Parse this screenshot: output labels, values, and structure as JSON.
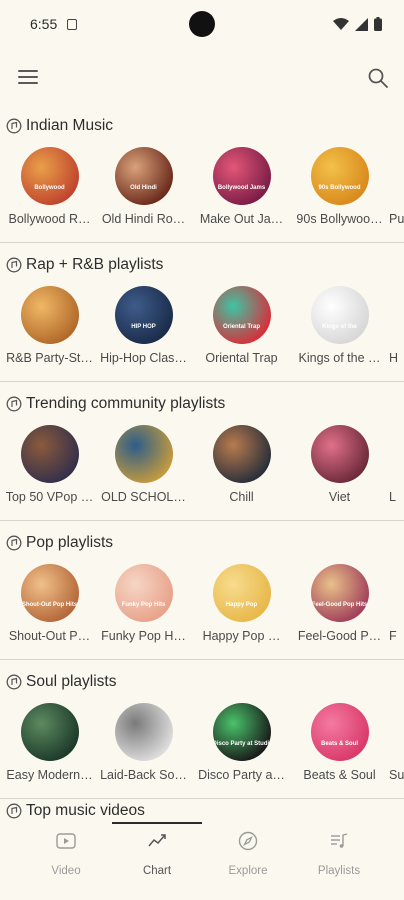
{
  "status": {
    "time": "6:55"
  },
  "sections": [
    {
      "title": "Indian Music",
      "items": [
        {
          "label": "Bollywood R…",
          "badge": "Bollywood",
          "colors": [
            "#c0442e",
            "#e9a04a"
          ]
        },
        {
          "label": "Old Hindi Ro…",
          "badge": "Old Hindi",
          "colors": [
            "#6b2a1c",
            "#d9a27a"
          ]
        },
        {
          "label": "Make Out Ja…",
          "badge": "Bollywood Jams",
          "colors": [
            "#7b1d47",
            "#e35778"
          ]
        },
        {
          "label": "90s Bollywoo…",
          "badge": "90s Bollywood",
          "colors": [
            "#d98a1c",
            "#f3c04a"
          ]
        }
      ],
      "peek": "Pu"
    },
    {
      "title": "Rap + R&B playlists",
      "items": [
        {
          "label": "R&B Party-St…",
          "badge": "",
          "colors": [
            "#b1692a",
            "#f0b866"
          ]
        },
        {
          "label": "Hip-Hop Clas…",
          "badge": "HIP HOP",
          "colors": [
            "#1b2c4a",
            "#3e5c8a"
          ]
        },
        {
          "label": "Oriental Trap",
          "badge": "Oriental Trap",
          "colors": [
            "#d6303b",
            "#3fc4a3"
          ]
        },
        {
          "label": "Kings of the …",
          "badge": "Kings of the",
          "colors": [
            "#d7d7d7",
            "#ffffff"
          ]
        }
      ],
      "peek": "H"
    },
    {
      "title": "Trending community playlists",
      "items": [
        {
          "label": "Top 50 VPop …",
          "badge": "",
          "colors": [
            "#34304a",
            "#8b5a3c"
          ]
        },
        {
          "label": "OLD SCHOL…",
          "badge": "",
          "colors": [
            "#c49a3e",
            "#2c5d8a"
          ]
        },
        {
          "label": "Chill",
          "badge": "",
          "colors": [
            "#2a2f3a",
            "#b87b4e"
          ]
        },
        {
          "label": "Viet",
          "badge": "",
          "colors": [
            "#6d2a3a",
            "#e0708a"
          ]
        }
      ],
      "peek": "L"
    },
    {
      "title": "Pop playlists",
      "items": [
        {
          "label": "Shout-Out P…",
          "badge": "Shout-Out Pop Hits",
          "colors": [
            "#b5683a",
            "#f0c08a"
          ]
        },
        {
          "label": "Funky Pop H…",
          "badge": "Funky Pop Hits",
          "colors": [
            "#e8a28a",
            "#f6d6c6"
          ]
        },
        {
          "label": "Happy Pop …",
          "badge": "Happy Pop",
          "colors": [
            "#e8b84a",
            "#f7dc8e"
          ]
        },
        {
          "label": "Feel-Good P…",
          "badge": "Feel-Good Pop Hits",
          "colors": [
            "#a0405a",
            "#e9c18a"
          ]
        }
      ],
      "peek": "F"
    },
    {
      "title": "Soul playlists",
      "items": [
        {
          "label": "Easy Modern…",
          "badge": "",
          "colors": [
            "#1c3a2a",
            "#5d8a60"
          ]
        },
        {
          "label": "Laid-Back So…",
          "badge": "",
          "colors": [
            "#dddddd",
            "#7a7a7a"
          ]
        },
        {
          "label": "Disco Party a…",
          "badge": "Disco Party at Studio 54",
          "colors": [
            "#1a1a1a",
            "#4ac36a"
          ]
        },
        {
          "label": "Beats & Soul",
          "badge": "Beats & Soul",
          "colors": [
            "#d93a6a",
            "#f47aa2"
          ]
        }
      ],
      "peek": "Su"
    }
  ],
  "partial_section": {
    "title": "Top music videos"
  },
  "nav": [
    {
      "label": "Video",
      "icon": "video-icon",
      "active": false
    },
    {
      "label": "Chart",
      "icon": "chart-icon",
      "active": true
    },
    {
      "label": "Explore",
      "icon": "compass-icon",
      "active": false
    },
    {
      "label": "Playlists",
      "icon": "playlist-icon",
      "active": false
    }
  ],
  "colors": {
    "background": "#fbf9ef",
    "text": "#2b2b2b",
    "muted": "#9a9a9a"
  }
}
